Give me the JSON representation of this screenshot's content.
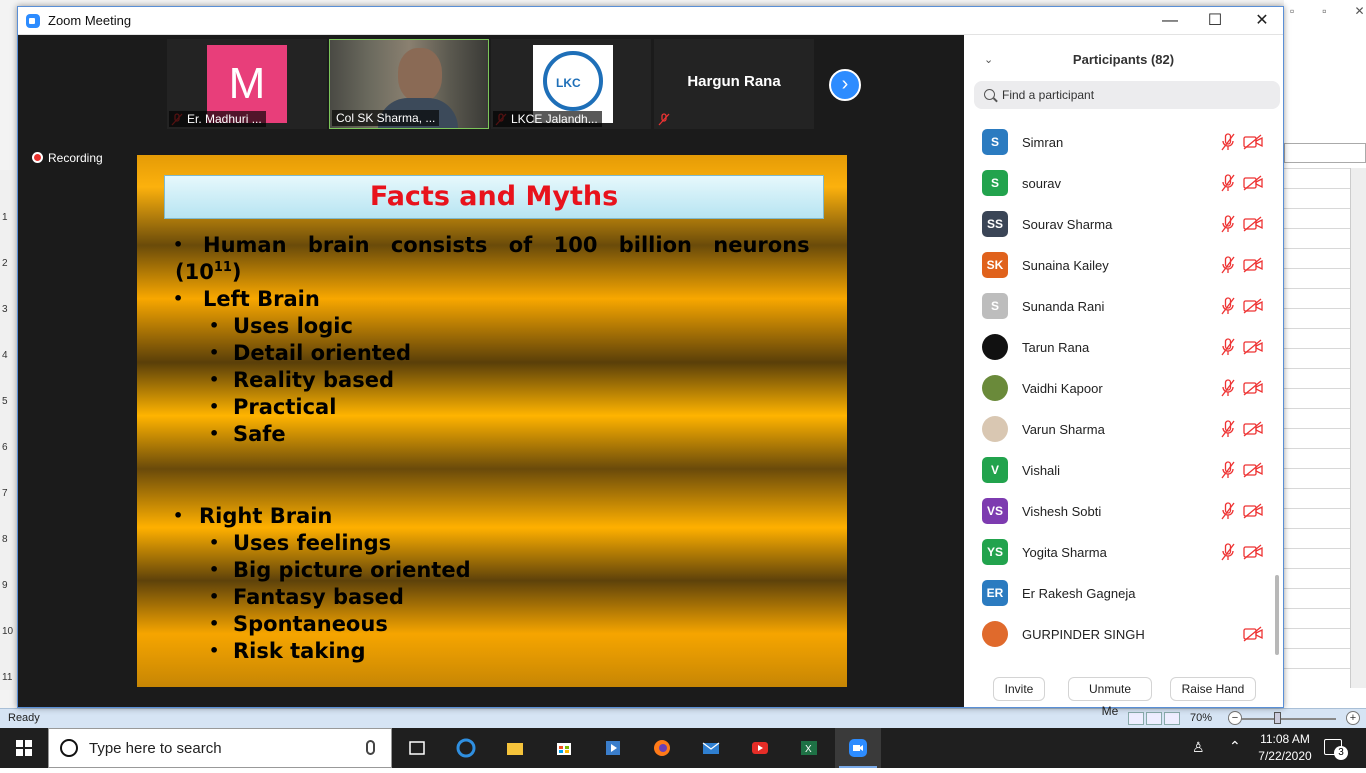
{
  "window": {
    "title": "Zoom Meeting"
  },
  "video_strip": {
    "thumbs": [
      {
        "name": "Er. Madhuri ...",
        "avatar_letter": "M"
      },
      {
        "name": "Col SK Sharma, ..."
      },
      {
        "name": "LKCE Jalandh...",
        "logo_text": "LKC"
      },
      {
        "name": "Hargun Rana"
      }
    ],
    "recording_label": "Recording"
  },
  "slide": {
    "title": "Facts and Myths",
    "lines": [
      {
        "bullet": "•",
        "text": "Human brain consists of 100 billion neurons"
      },
      {
        "text": "(10",
        "sup": "11",
        "text_end": ")"
      },
      {
        "bullet": "•",
        "text": "Left Brain"
      },
      {
        "bullet": "•",
        "text": "Uses logic"
      },
      {
        "bullet": "•",
        "text": "Detail oriented"
      },
      {
        "bullet": "•",
        "text": "Reality based"
      },
      {
        "bullet": "•",
        "text": "Practical"
      },
      {
        "bullet": "•",
        "text": "Safe"
      },
      {
        "bullet": "•",
        "text": "Right Brain"
      },
      {
        "bullet": "•",
        "text": "Uses feelings"
      },
      {
        "bullet": "•",
        "text": "Big picture oriented"
      },
      {
        "bullet": "•",
        "text": "Fantasy based"
      },
      {
        "bullet": "•",
        "text": "Spontaneous"
      },
      {
        "bullet": "•",
        "text": "Risk taking"
      }
    ]
  },
  "participants": {
    "title": "Participants (82)",
    "search_placeholder": "Find a participant",
    "list": [
      {
        "initials": "S",
        "name": "Simran",
        "color": "#2b7bc0",
        "mic_muted": true,
        "video_off": true
      },
      {
        "initials": "S",
        "name": "sourav",
        "color": "#22a34d",
        "mic_muted": true,
        "video_off": true
      },
      {
        "initials": "SS",
        "name": "Sourav Sharma",
        "color": "#3a4556",
        "mic_muted": true,
        "video_off": true
      },
      {
        "initials": "SK",
        "name": "Sunaina Kailey",
        "color": "#e0621c",
        "mic_muted": true,
        "video_off": true
      },
      {
        "initials": "S",
        "name": "Sunanda Rani",
        "color": "#bdbdbd",
        "mic_muted": true,
        "video_off": true
      },
      {
        "initials": "",
        "name": "Tarun Rana",
        "color": "#111111",
        "mic_muted": true,
        "video_off": true
      },
      {
        "initials": "",
        "name": "Vaidhi Kapoor",
        "color": "#6a8a3a",
        "mic_muted": true,
        "video_off": true
      },
      {
        "initials": "",
        "name": "Varun Sharma",
        "color": "#d9c7b2",
        "mic_muted": true,
        "video_off": true
      },
      {
        "initials": "V",
        "name": "Vishali",
        "color": "#22a34d",
        "mic_muted": true,
        "video_off": true
      },
      {
        "initials": "VS",
        "name": "Vishesh Sobti",
        "color": "#7d3bb0",
        "mic_muted": true,
        "video_off": true
      },
      {
        "initials": "YS",
        "name": "Yogita Sharma",
        "color": "#22a34d",
        "mic_muted": true,
        "video_off": true
      },
      {
        "initials": "ER",
        "name": "Er Rakesh Gagneja",
        "color": "#2b7bc0",
        "mic_muted": false,
        "video_off": false
      },
      {
        "initials": "",
        "name": "GURPINDER SINGH",
        "color": "#e06a2c",
        "mic_muted": false,
        "video_off": true
      }
    ],
    "buttons": {
      "invite": "Invite",
      "unmute": "Unmute Me",
      "raise": "Raise Hand"
    }
  },
  "excel": {
    "status": "Ready",
    "zoom": "70%",
    "row_numbers": [
      "1",
      "2",
      "3",
      "4",
      "5",
      "6",
      "7",
      "8",
      "9",
      "10",
      "11"
    ]
  },
  "taskbar": {
    "search_placeholder": "Type here to search",
    "time": "11:08 AM",
    "date": "7/22/2020",
    "notifications": "3"
  }
}
